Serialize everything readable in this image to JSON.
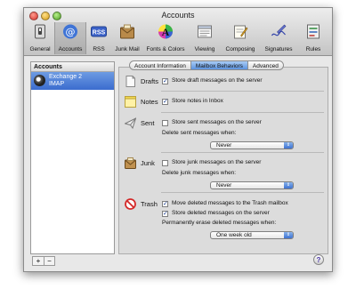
{
  "window": {
    "title": "Accounts"
  },
  "toolbar": {
    "items": [
      {
        "label": "General",
        "icon": "general-switch-icon"
      },
      {
        "label": "Accounts",
        "icon": "at-sign-icon"
      },
      {
        "label": "RSS",
        "icon": "rss-icon"
      },
      {
        "label": "Junk Mail",
        "icon": "junk-mail-icon"
      },
      {
        "label": "Fonts & Colors",
        "icon": "fonts-colors-icon"
      },
      {
        "label": "Viewing",
        "icon": "viewing-icon"
      },
      {
        "label": "Composing",
        "icon": "composing-icon"
      },
      {
        "label": "Signatures",
        "icon": "signatures-icon"
      },
      {
        "label": "Rules",
        "icon": "rules-icon"
      }
    ],
    "selected": "Accounts"
  },
  "accounts": {
    "header": "Accounts",
    "items": [
      {
        "name": "Exchange 2",
        "type": "IMAP",
        "selected": true
      }
    ],
    "add_label": "+",
    "remove_label": "−"
  },
  "help": {
    "label": "?"
  },
  "tabs": [
    {
      "label": "Account Information",
      "selected": false
    },
    {
      "label": "Mailbox Behaviors",
      "selected": true
    },
    {
      "label": "Advanced",
      "selected": false
    }
  ],
  "sections": {
    "drafts": {
      "title": "Drafts",
      "option": "Store draft messages on the server",
      "checked": true
    },
    "notes": {
      "title": "Notes",
      "option": "Store notes in Inbox",
      "checked": true
    },
    "sent": {
      "title": "Sent",
      "option": "Store sent messages on the server",
      "checked": false,
      "delete_label": "Delete sent messages when:",
      "delete_value": "Never"
    },
    "junk": {
      "title": "Junk",
      "option": "Store junk messages on the server",
      "checked": false,
      "delete_label": "Delete junk messages when:",
      "delete_value": "Never"
    },
    "trash": {
      "title": "Trash",
      "option1": "Move deleted messages to the Trash mailbox",
      "option1_checked": true,
      "option2": "Store deleted messages on the server",
      "option2_checked": true,
      "erase_label": "Permanently erase deleted messages when:",
      "erase_value": "One week old"
    }
  },
  "colors": {
    "selection": "#3b6ccf",
    "popup_arrow": "#3e72d1",
    "window_bg": "#e8e8e8"
  }
}
